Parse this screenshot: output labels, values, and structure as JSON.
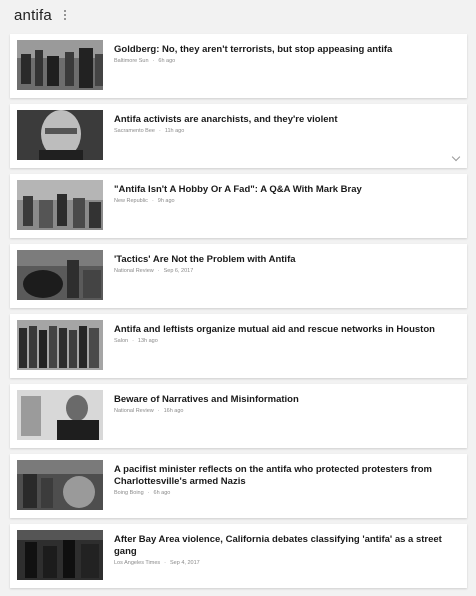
{
  "header": {
    "query": "antifa"
  },
  "articles": [
    {
      "title": "Goldberg: No, they aren't terrorists, but stop appeasing antifa",
      "source": "Baltimore Sun",
      "time": "6h ago"
    },
    {
      "title": "Antifa activists are anarchists, and they're violent",
      "source": "Sacramento Bee",
      "time": "11h ago"
    },
    {
      "title": "\"Antifa Isn't A Hobby Or A Fad\": A Q&A With Mark Bray",
      "source": "New Republic",
      "time": "9h ago"
    },
    {
      "title": "'Tactics' Are Not the Problem with Antifa",
      "source": "National Review",
      "time": "Sep 6, 2017"
    },
    {
      "title": "Antifa and leftists organize mutual aid and rescue networks in Houston",
      "source": "Salon",
      "time": "13h ago"
    },
    {
      "title": "Beware of Narratives and Misinformation",
      "source": "National Review",
      "time": "16h ago"
    },
    {
      "title": "A pacifist minister reflects on the antifa who protected protesters from Charlottesville's armed Nazis",
      "source": "Boing Boing",
      "time": "6h ago"
    },
    {
      "title": "After Bay Area violence, California debates classifying 'antifa' as a street gang",
      "source": "Los Angeles Times",
      "time": "Sep 4, 2017"
    }
  ]
}
